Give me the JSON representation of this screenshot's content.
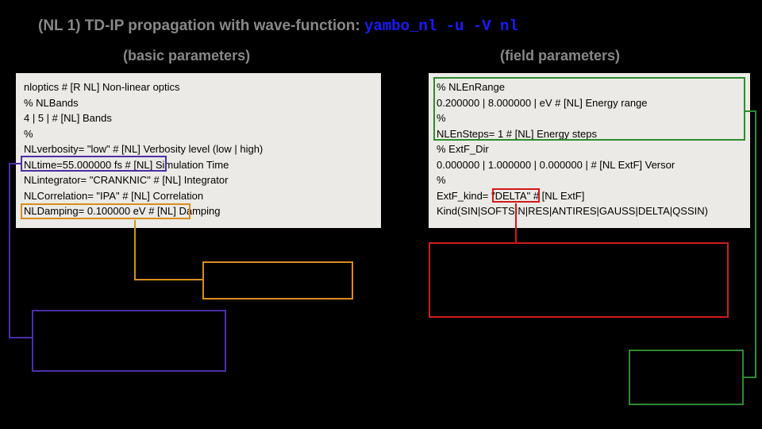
{
  "title_prefix": "(NL 1) TD-IP propagation with wave-function:  ",
  "title_cmd": "yambo_nl -u -V nl",
  "subhead_left": "(basic parameters)",
  "subhead_right": "(field parameters)",
  "left": {
    "l1": "nloptics                       # [R NL] Non-linear optics",
    "l2": "% NLBands",
    "l3": "  4 | 5 |                      # [NL] Bands",
    "l4": "%",
    "l5": "NLverbosity= \"low\"            # [NL] Verbosity level (low | high)",
    "l6": "NLtime=55.000000         fs       # [NL] Simulation Time",
    "l7": "NLintegrator= \"CRANKNIC\"        # [NL] Integrator",
    "l8": "NLCorrelation= \"IPA\"          # [NL] Correlation",
    "l9": "NLDamping= 0.100000       eV     # [NL] Damping"
  },
  "right": {
    "l1": "% NLEnRange",
    "l2": " 0.200000 | 8.000000 | eV           # [NL] Energy range",
    "l3": "%",
    "l4": "NLEnSteps=  1                 # [NL] Energy steps",
    "l5": "% ExtF_Dir",
    "l6": " 0.000000 | 1.000000 | 0.000000 |            # [NL ExtF] Versor",
    "l7": "%",
    "l8": "ExtF_kind= \"DELTA\"           # [NL ExtF]",
    "l9": "Kind(SIN|SOFTSIN|RES|ANTIRES|GAUSS|DELTA|QSSIN)"
  },
  "chart_data": {
    "type": "table",
    "title": "TD-IP propagation with wave-function: yambo_nl -u -V nl",
    "basic_parameters": [
      {
        "key": "nloptics",
        "comment": "[R NL] Non-linear optics"
      },
      {
        "key": "NLBands",
        "value": "4 | 5",
        "comment": "[NL] Bands"
      },
      {
        "key": "NLverbosity",
        "value": "low",
        "comment": "[NL] Verbosity level (low | high)"
      },
      {
        "key": "NLtime",
        "value": 55.0,
        "unit": "fs",
        "comment": "[NL] Simulation Time"
      },
      {
        "key": "NLintegrator",
        "value": "CRANKNIC",
        "comment": "[NL] Integrator"
      },
      {
        "key": "NLCorrelation",
        "value": "IPA",
        "comment": "[NL] Correlation"
      },
      {
        "key": "NLDamping",
        "value": 0.1,
        "unit": "eV",
        "comment": "[NL] Damping"
      }
    ],
    "field_parameters": [
      {
        "key": "NLEnRange",
        "value": [
          0.2,
          8.0
        ],
        "unit": "eV",
        "comment": "[NL] Energy range"
      },
      {
        "key": "NLEnSteps",
        "value": 1,
        "comment": "[NL] Energy steps"
      },
      {
        "key": "ExtF_Dir",
        "value": [
          0.0,
          1.0,
          0.0
        ],
        "comment": "[NL ExtF] Versor"
      },
      {
        "key": "ExtF_kind",
        "value": "DELTA",
        "comment": "[NL ExtF] Kind",
        "options": [
          "SIN",
          "SOFTSIN",
          "RES",
          "ANTIRES",
          "GAUSS",
          "DELTA",
          "QSSIN"
        ]
      }
    ],
    "highlights": [
      {
        "param": "NLtime",
        "color": "purple"
      },
      {
        "param": "NLDamping",
        "color": "orange"
      },
      {
        "param": "NLEnRange",
        "color": "green"
      },
      {
        "param": "NLEnSteps",
        "color": "green"
      },
      {
        "param": "ExtF_kind",
        "color": "red"
      }
    ]
  }
}
